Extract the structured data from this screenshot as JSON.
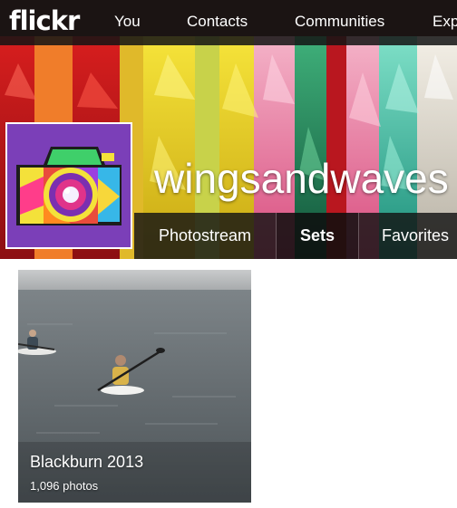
{
  "nav": {
    "logo": "flickr",
    "items": [
      "You",
      "Contacts",
      "Communities",
      "Exp"
    ]
  },
  "profile": {
    "username": "wingsandwaves",
    "avatar_icon": "camera-icon"
  },
  "subnav": {
    "tabs": [
      "Photostream",
      "Sets",
      "Favorites"
    ],
    "active": "Sets"
  },
  "sets": [
    {
      "title": "Blackburn 2013",
      "count": "1,096 photos"
    }
  ]
}
